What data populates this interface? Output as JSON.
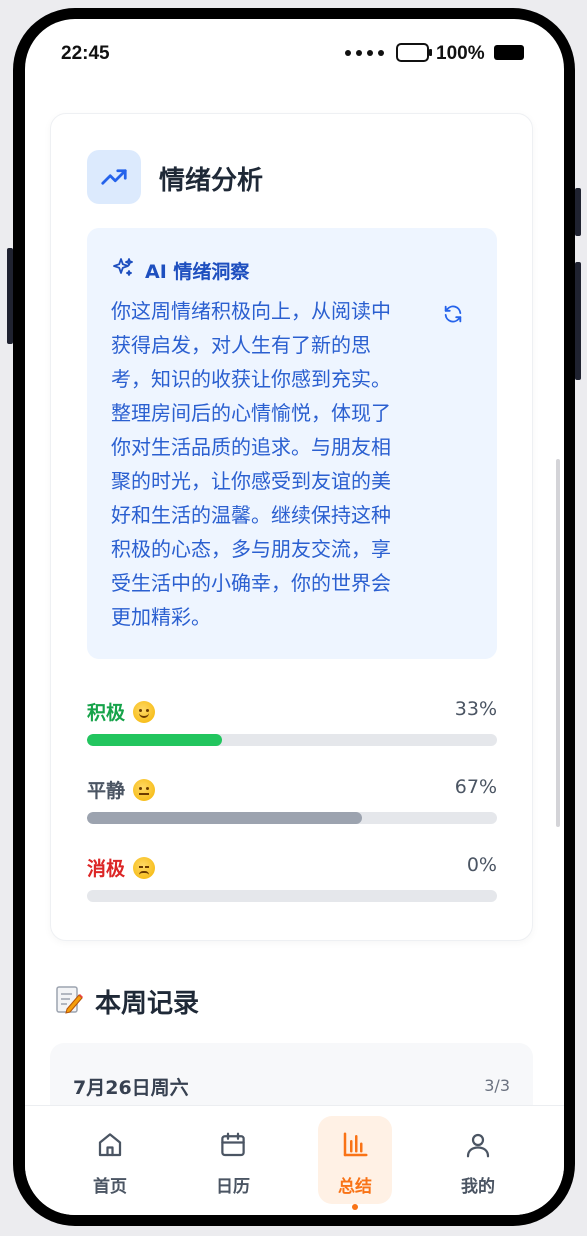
{
  "status_bar": {
    "time": "22:45",
    "battery": "100%"
  },
  "analysis": {
    "title": "情绪分析",
    "insight_title": "AI 情绪洞察",
    "insight_lines": [
      "你这周情绪积极向上，从阅读中",
      "获得启发，对人生有了新的思",
      "考，知识的收获让你感到充实。",
      "整理房间后的心情愉悦，体现了",
      "你对生活品质的追求。与朋友相",
      "聚的时光，让你感受到友谊的美",
      "好和生活的温馨。继续保持这种",
      "积极的心态，多与朋友交流，享",
      "受生活中的小确幸，你的世界会",
      "更加精彩。"
    ],
    "emotions": [
      {
        "label": "积极",
        "percent": "33%",
        "value": 0.33,
        "color": "#22c55e",
        "label_color": "#16a34a",
        "face": "smiling-face-icon"
      },
      {
        "label": "平静",
        "percent": "67%",
        "value": 0.67,
        "color": "#9ca3af",
        "label_color": "#4b5563",
        "face": "neutral-face-icon"
      },
      {
        "label": "消极",
        "percent": "0%",
        "value": 0.0,
        "color": "#ef4444",
        "label_color": "#dc2626",
        "face": "pensive-face-icon"
      }
    ]
  },
  "week": {
    "title": "本周记录",
    "day_label": "7月26日周六",
    "day_count": "3/3"
  },
  "tabs": [
    {
      "label": "首页",
      "icon": "home-icon"
    },
    {
      "label": "日历",
      "icon": "calendar-icon"
    },
    {
      "label": "总结",
      "icon": "bar-chart-icon",
      "active": true
    },
    {
      "label": "我的",
      "icon": "user-icon"
    }
  ],
  "colors": {
    "accent": "#f97316",
    "insight_text": "#2a5fd0",
    "insight_bg": "#eef5ff"
  }
}
